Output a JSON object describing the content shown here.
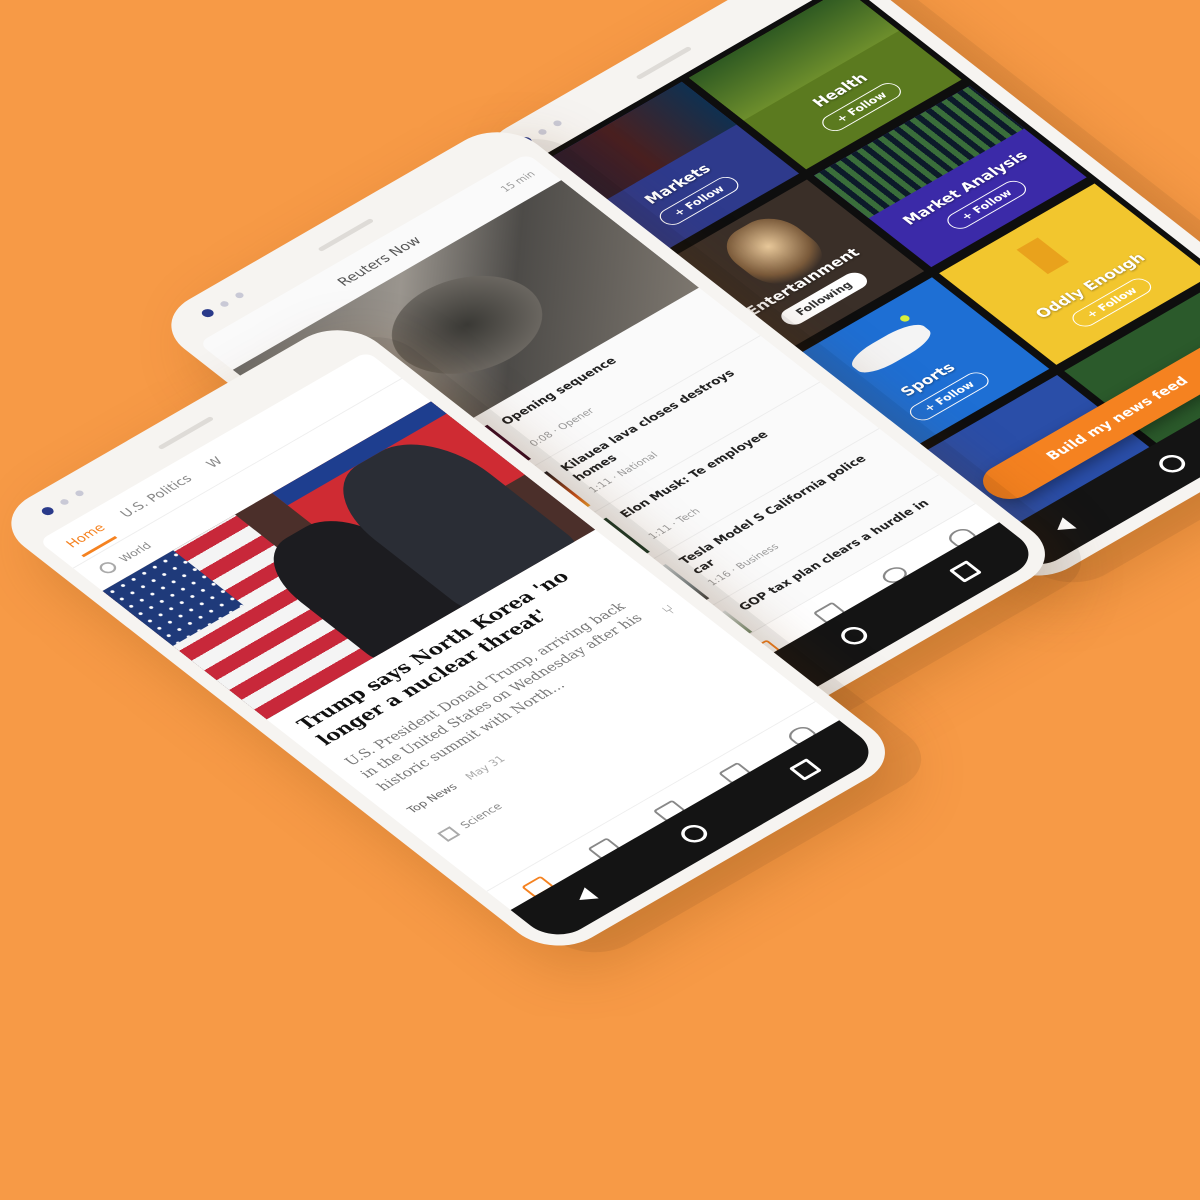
{
  "topics_phone": {
    "tiles": [
      {
        "name": "Markets",
        "button": "Follow",
        "following": false,
        "bg": "#2e3a8c"
      },
      {
        "name": "Health",
        "button": "Follow",
        "following": false,
        "bg": "#5b7a1f"
      },
      {
        "name": "Entertainment",
        "button": "Following",
        "following": true,
        "bg": "#3a2f28"
      },
      {
        "name": "Market Analysis",
        "button": "Follow",
        "following": false,
        "bg": "#3b2aa8"
      },
      {
        "name": "Sports",
        "button": "Follow",
        "following": false,
        "bg": "#1e6fd4"
      },
      {
        "name": "Oddly Enough",
        "button": "Follow",
        "following": false,
        "bg": "#f2c62e"
      }
    ],
    "build_button": "Build my news feed",
    "accent": "#f58220"
  },
  "reuters_now_phone": {
    "title": "Reuters Now",
    "time": "15 min",
    "items": [
      {
        "title": "Opening sequence",
        "meta": "0:08 · Opener"
      },
      {
        "title": "Kilauea lava closes destroys homes",
        "meta": "1:11 · National"
      },
      {
        "title": "Elon Musk: Te employee",
        "meta": "1:11 · Tech"
      },
      {
        "title": "Tesla Model S California police car",
        "meta": "1:16 · Business"
      },
      {
        "title": "GOP tax plan clears a hurdle in",
        "meta": ""
      }
    ]
  },
  "home_phone": {
    "tabs": [
      "Home",
      "U.S. Politics",
      "W"
    ],
    "section": "World",
    "headline": "Trump says North Korea 'no longer a nuclear threat'",
    "summary": "U.S. President Donald Trump, arriving back in the United States on Wednesday after his historic summit with North...",
    "category": "Top News",
    "date": "May 31",
    "next_section": "Science"
  }
}
